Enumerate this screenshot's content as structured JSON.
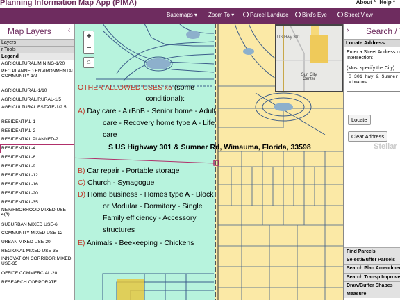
{
  "app": {
    "title": "Planning Information Map App (PIMA)"
  },
  "top_links": {
    "about": "About *",
    "help": "Help *",
    "more": ""
  },
  "toolbar": {
    "items": [
      {
        "label": "Basemaps",
        "icon": "chevron-down-icon"
      },
      {
        "label": "Zoom To",
        "icon": "chevron-down-icon"
      },
      {
        "label": "Parcel Landuse",
        "icon": "parcel-icon"
      },
      {
        "label": "Bird's Eye",
        "icon": "bird-icon"
      },
      {
        "label": "Street View",
        "icon": "street-view-icon"
      }
    ]
  },
  "left_panel": {
    "title": "Map Layers",
    "close_icon": "chevron-left-icon",
    "sections": {
      "layers": "Layers",
      "tools": "r Tools",
      "legend": "Legend"
    },
    "legend_items": [
      "AGRICULTURAL/MINING-1/20",
      "PEC PLANNED ENVIRONMENTAL COMMUNITY-1/2",
      "AGRICULTURAL-1/10",
      "AGRICULTURAL/RURAL-1/5",
      "AGRICULTURAL ESTATE-1/2.5",
      "RESIDENTIAL-1",
      "RESIDENTIAL-2",
      "RESIDENTIAL PLANNED-2",
      "RESIDENTIAL-4",
      "RESIDENTIAL-6",
      "RESIDENTIAL-9",
      "RESIDENTIAL-12",
      "RESIDENTIAL-16",
      "RESIDENTIAL-20",
      "RESIDENTIAL-35",
      "NEIGHBORHOOD MIXED USE-4(3)",
      "SUBURBAN MIXED USE-6",
      "COMMUNITY MIXED USE-12",
      "URBAN MIXED USE-20",
      "REGIONAL MIXED USE-35",
      "INNOVATION CORRIDOR MIXED USE-35",
      "OFFICE COMMERCIAL-20",
      "RESEARCH CORPORATE"
    ]
  },
  "map": {
    "overview": {
      "place_label": "Sun City Center",
      "road_label": "US Hwy 301"
    },
    "overlay": {
      "heading_colored": "OTHER ALLOWED USES x5",
      "heading_rest": " (some",
      "heading_line2": "conditional):",
      "items": [
        {
          "letter": "A)",
          "lines": [
            "Day care - AirBnB - Senior home - Adult",
            "care - Recovery home type A - Life",
            "care"
          ]
        },
        {
          "letter": "B)",
          "lines": [
            "Car repair - Portable storage"
          ]
        },
        {
          "letter": "C)",
          "lines": [
            "Church - Synagogue"
          ]
        },
        {
          "letter": "D)",
          "lines": [
            "Home business - Homes type A - Block",
            "or Modular - Dormitory - Single",
            "Family efficiency - Accessory",
            "structures"
          ]
        },
        {
          "letter": "E)",
          "lines": [
            "Animals - Beekeeping - Chickens"
          ]
        }
      ],
      "address": "S US Highway 301 & Sumner Rd, Wimauma, Florida, 33598"
    },
    "colors": {
      "residential": "#fbe9a6",
      "overlay": "#b7f3dd",
      "parcel": "#3b5c8a",
      "pointer": "#b0306a"
    }
  },
  "watermark": "Stellar",
  "right_panel": {
    "title": "Search / To",
    "close_icon": "chevron-right-icon",
    "locate_title": "Locate Address",
    "hint1": "Enter a Street Address or Intersection:",
    "hint2": "(Must specify the City)",
    "input_value": "S 301 hwy & Sumner\nWimauma",
    "locate_button": "Locate",
    "clear_button": "Clear Address",
    "tools": [
      "Find Parcels",
      "Select/Buffer Parcels",
      "Search Plan Amendments",
      "Search Transp Improvements",
      "Draw/Buffer Shapes",
      "Measure"
    ]
  }
}
